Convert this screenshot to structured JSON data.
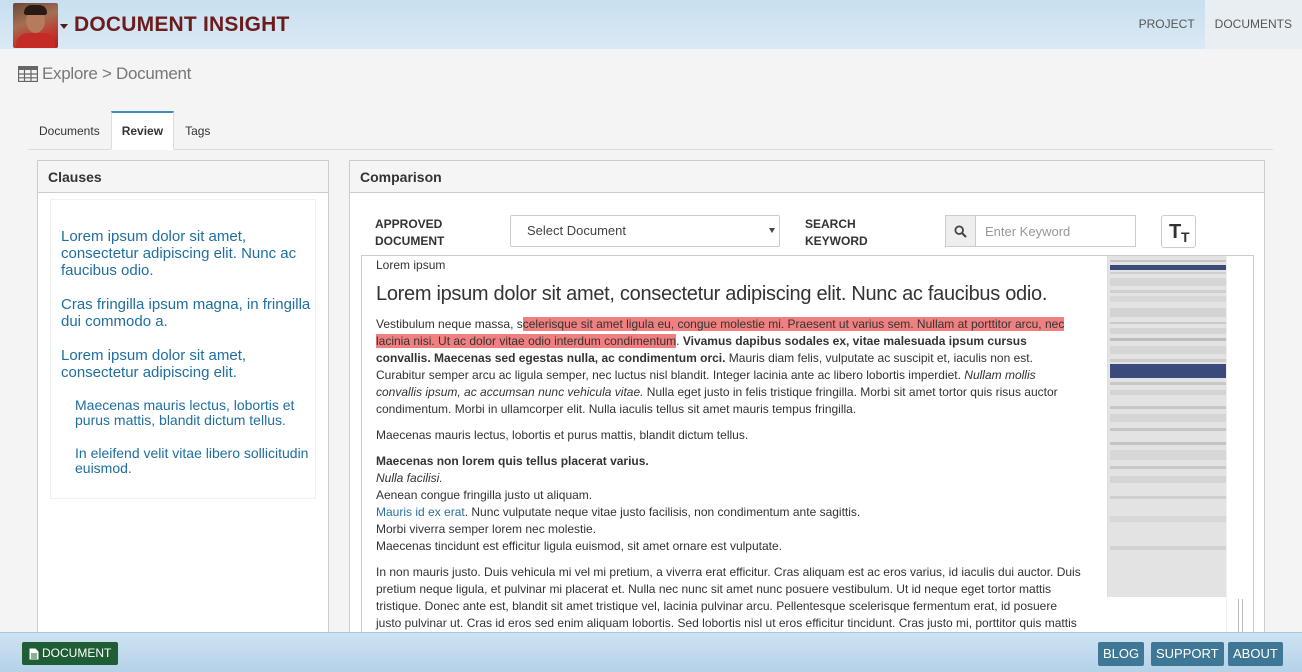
{
  "header": {
    "brand": "DOCUMENT INSIGHT",
    "nav": [
      {
        "label": "PROJECT"
      },
      {
        "label": "DOCUMENTS"
      }
    ]
  },
  "breadcrumb": {
    "text": "Explore > Document",
    "icon": "table-grid-icon"
  },
  "tabs": [
    {
      "label": "Documents"
    },
    {
      "label": "Review"
    },
    {
      "label": "Tags"
    }
  ],
  "clauses": {
    "title": "Clauses",
    "items": [
      {
        "text": "Lorem ipsum dolor sit amet, consectetur adipiscing elit. Nunc ac faucibus odio."
      },
      {
        "text": "Cras fringilla ipsum magna, in fringilla dui commodo a."
      },
      {
        "text": "Lorem ipsum dolor sit amet, consectetur adipiscing elit."
      },
      {
        "text": "Maecenas mauris lectus, lobortis et purus mattis, blandit dictum tellus."
      },
      {
        "text": "In eleifend velit vitae libero sollicitudin euismod."
      }
    ]
  },
  "comparison": {
    "title": "Comparison",
    "approved_label_1": "APPROVED",
    "approved_label_2": "DOCUMENT",
    "select_value": "Select Document",
    "search_label_1": "SEARCH",
    "search_label_2": "KEYWORD",
    "search_placeholder": "Enter Keyword",
    "text_size_big": "T",
    "text_size_small": "T",
    "highlight_color": "#f08080"
  },
  "document": {
    "kicker": "Lorem ipsum",
    "heading": "Lorem ipsum dolor sit amet, consectetur adipiscing elit. Nunc ac faucibus odio.",
    "p1_a": "Vestibulum neque massa, s",
    "p1_hl": "celerisque sit amet ligula eu, congue molestie mi. Praesent ut varius sem. Nullam at porttitor arcu, nec lacinia nisi. Ut ac dolor vitae odio interdum condimentum",
    "p1_b": ". ",
    "p1_bold": "Vivamus dapibus sodales ex, vitae malesuada ipsum cursus convallis. Maecenas sed egestas nulla, ac condimentum orci.",
    "p1_c": " Mauris diam felis, vulputate ac suscipit et, iaculis non est. Curabitur semper arcu ac ligula semper, nec luctus nisl blandit. Integer lacinia ante ac libero lobortis imperdiet. ",
    "p1_italic": "Nullam mollis convallis ipsum, ac accumsan nunc vehicula vitae.",
    "p1_d": " Nulla eget justo in felis tristique fringilla. Morbi sit amet tortor quis risus auctor condimentum. Morbi in ullamcorper elit. Nulla iaculis tellus sit amet mauris tempus fringilla.",
    "p2": "Maecenas mauris lectus, lobortis et purus mattis, blandit dictum tellus.",
    "p3_bold": "Maecenas non lorem quis tellus placerat varius.",
    "p3_italic": "Nulla facilisi.",
    "p3_line3": "Aenean congue fringilla justo ut aliquam.",
    "p3_link": "Mauris id ex erat",
    "p3_line4": ". Nunc vulputate neque vitae justo facilisis, non condimentum ante sagittis.",
    "p3_line5": "Morbi viverra semper lorem nec molestie.",
    "p3_line6": "Maecenas tincidunt est efficitur ligula euismod, sit amet ornare est vulputate.",
    "p4": "In non mauris justo. Duis vehicula mi vel mi pretium, a viverra erat efficitur. Cras aliquam est ac eros varius, id iaculis dui auctor. Duis pretium neque ligula, et pulvinar mi placerat et. Nulla nec nunc sit amet nunc posuere vestibulum. Ut id neque eget tortor mattis tristique. Donec ante est, blandit sit amet tristique vel, lacinia pulvinar arcu. Pellentesque scelerisque fermentum erat, id posuere justo pulvinar ut. Cras id eros sed enim aliquam lobortis. Sed lobortis nisl ut eros efficitur tincidunt. Cras justo mi, porttitor quis mattis"
  },
  "footer": {
    "document_button": "DOCUMENT",
    "links": [
      {
        "label": "BLOG"
      },
      {
        "label": "SUPPORT"
      },
      {
        "label": "ABOUT"
      }
    ]
  }
}
